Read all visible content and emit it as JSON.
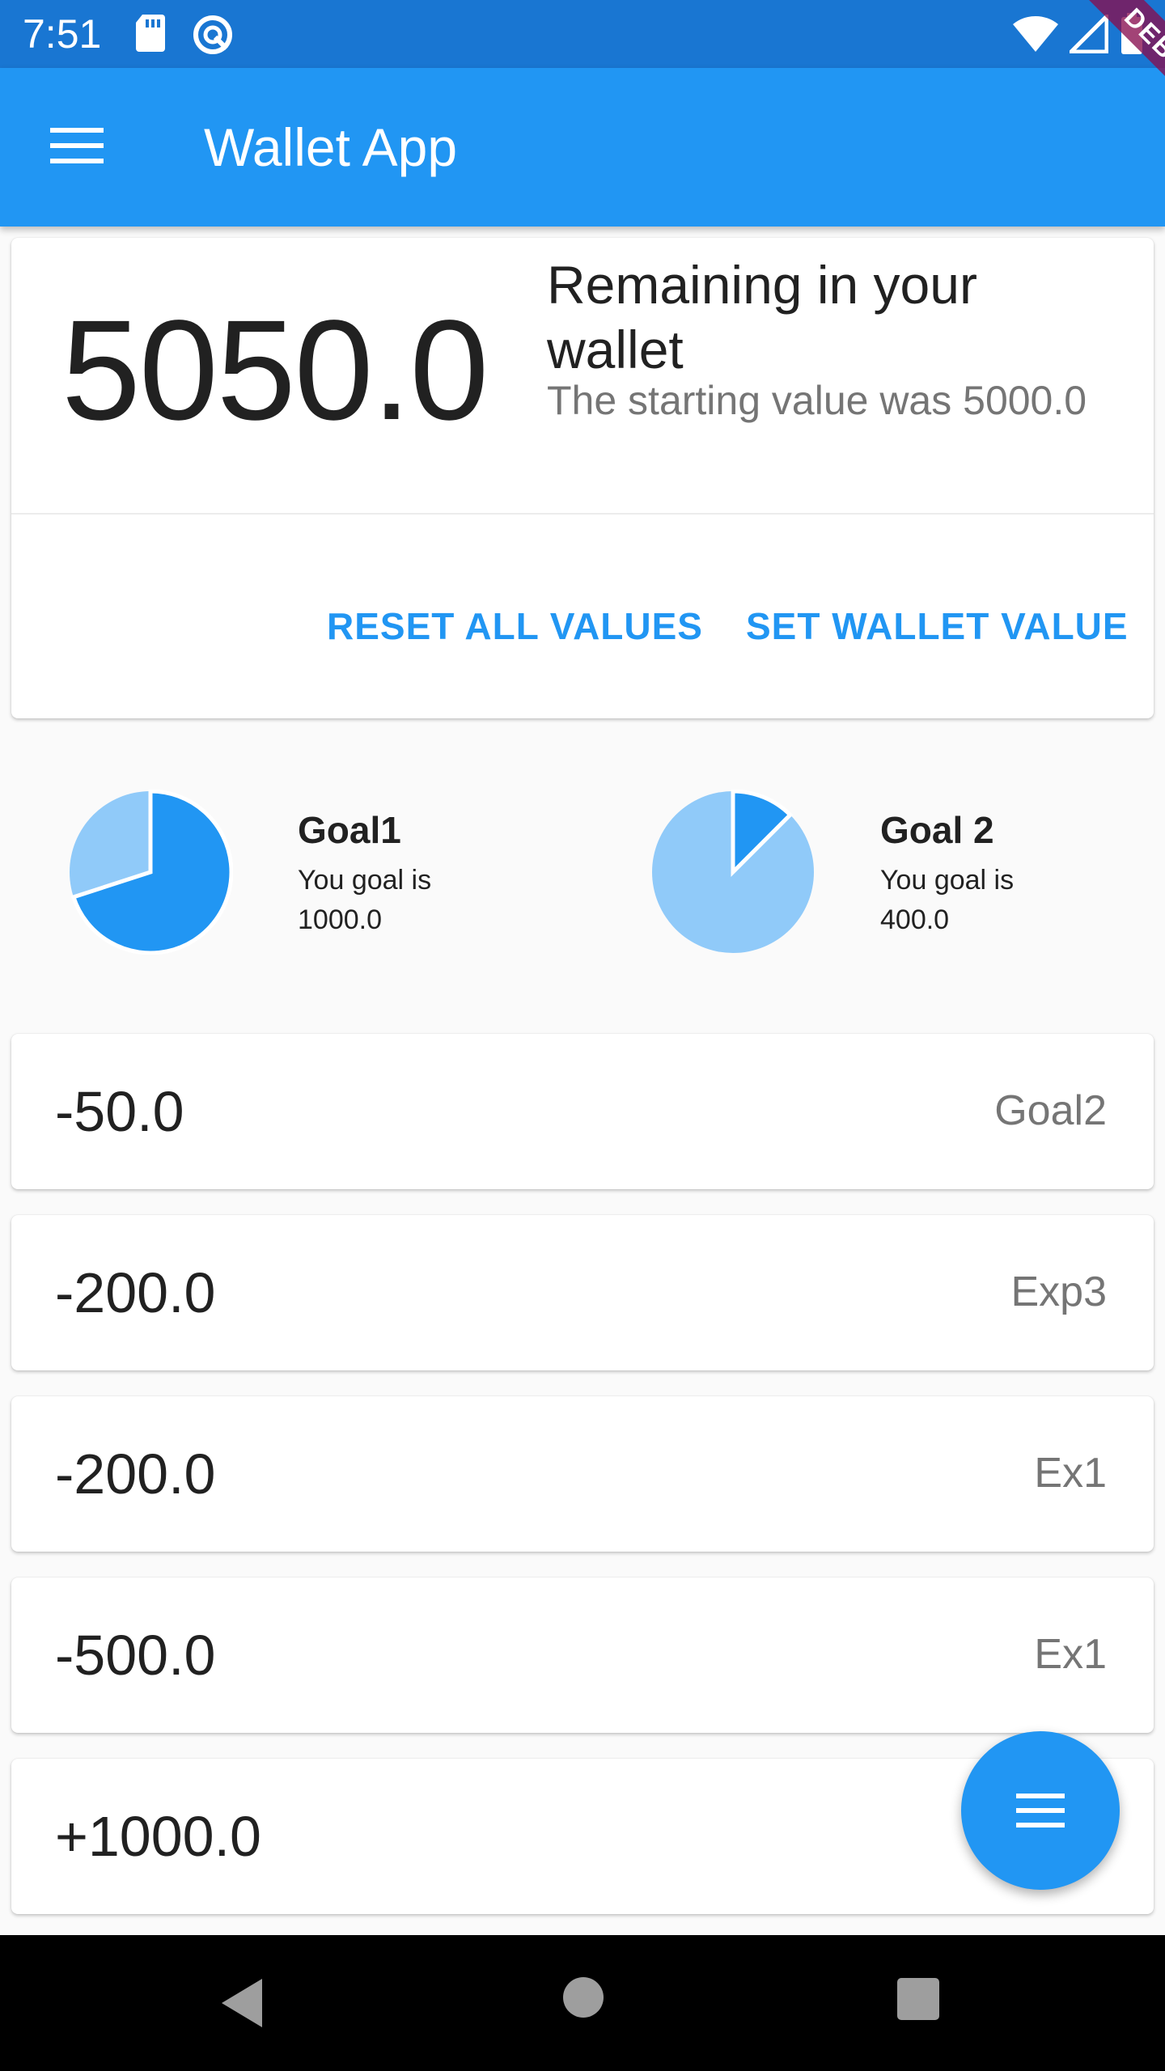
{
  "status_bar": {
    "time": "7:51",
    "icons": [
      "sd-card-icon",
      "data-saver-icon",
      "wifi-icon",
      "cell-signal-icon",
      "battery-icon"
    ]
  },
  "debug_banner": "DEBUG",
  "app_bar": {
    "title": "Wallet App",
    "menu_icon": "menu-icon"
  },
  "wallet": {
    "balance": "5050.0",
    "remaining_label": "Remaining in your wallet",
    "starting_text": "The starting value was 5000.0",
    "actions": {
      "reset": "RESET ALL VALUES",
      "set": "SET WALLET VALUE"
    }
  },
  "goals": [
    {
      "name": "Goal1",
      "desc": "You goal is 1000.0",
      "progress": 0.7
    },
    {
      "name": "Goal 2",
      "desc": "You goal is 400.0",
      "progress": 0.125
    }
  ],
  "transactions": [
    {
      "amount": "-50.0",
      "label": "Goal2"
    },
    {
      "amount": "-200.0",
      "label": "Exp3"
    },
    {
      "amount": "-200.0",
      "label": "Ex1"
    },
    {
      "amount": "-500.0",
      "label": "Ex1"
    },
    {
      "amount": "+1000.0",
      "label": ""
    }
  ],
  "fab": {
    "icon": "menu-icon"
  },
  "colors": {
    "primary": "#2196f3",
    "primary_dark": "#1976d2",
    "pie_light": "#90caf9",
    "debug": "#880e4f"
  }
}
